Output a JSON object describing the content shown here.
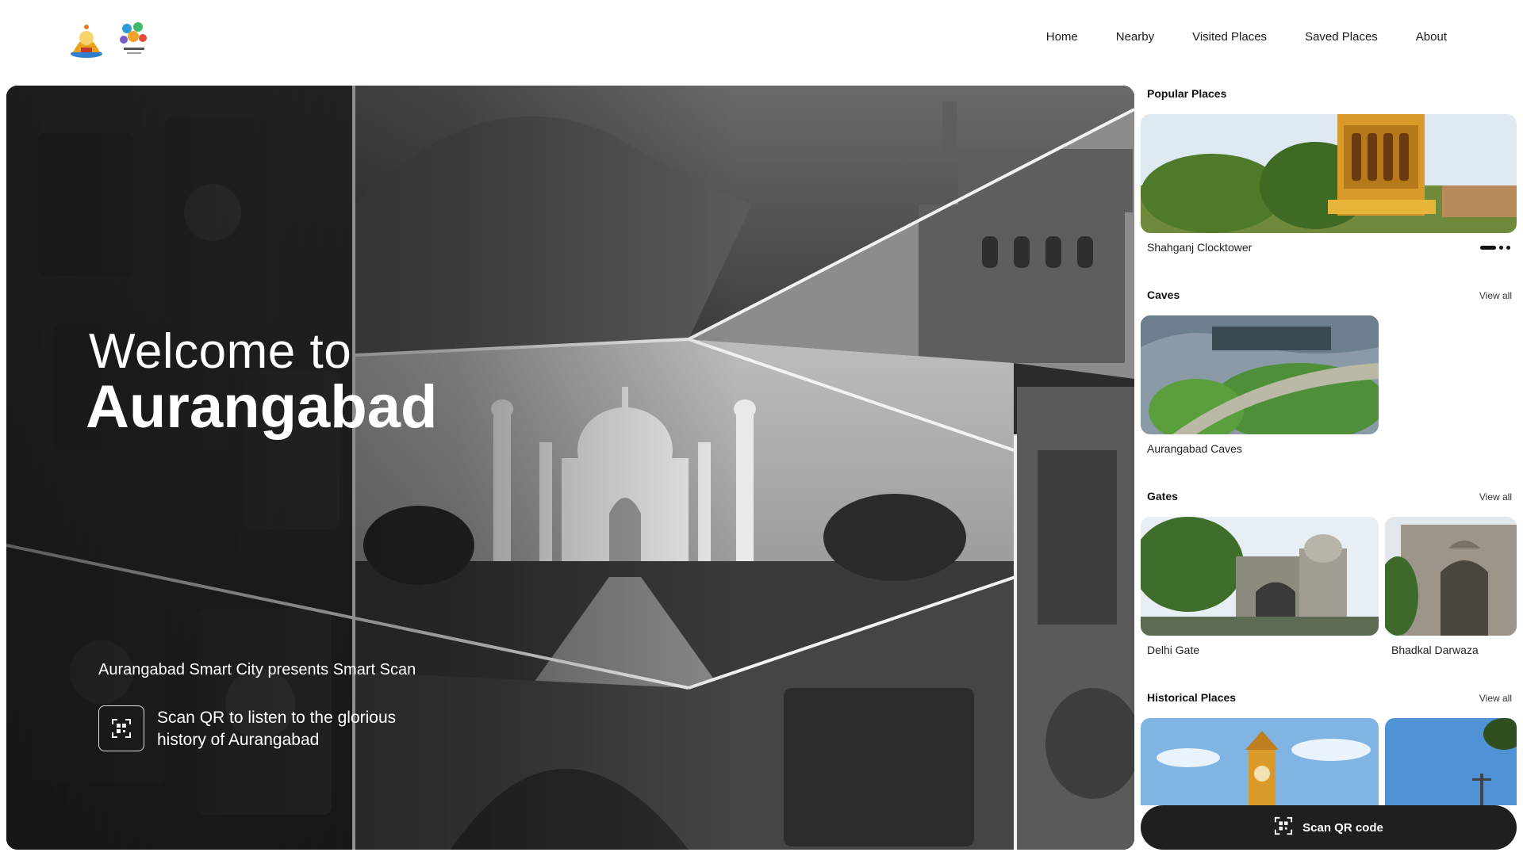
{
  "header": {
    "logos": [
      {
        "name": "aurangabad-municipal-emblem"
      },
      {
        "name": "aurangabad-smart-city-logo"
      }
    ],
    "nav": [
      "Home",
      "Nearby",
      "Visited Places",
      "Saved Places",
      "About"
    ]
  },
  "hero": {
    "welcome": "Welcome to",
    "city": "Aurangabad",
    "presents": "Aurangabad Smart City presents Smart Scan",
    "scan_text": "Scan QR to listen to the glorious history of Aurangabad",
    "icon": "qr-scan-icon"
  },
  "popular": {
    "title": "Popular Places",
    "item_label": "Shahganj Clocktower",
    "carousel": {
      "count": 3,
      "active": 0
    }
  },
  "caves": {
    "title": "Caves",
    "view_all": "View all",
    "items": [
      "Aurangabad Caves"
    ]
  },
  "gates": {
    "title": "Gates",
    "view_all": "View all",
    "items": [
      "Delhi Gate",
      "Bhadkal Darwaza"
    ]
  },
  "historical": {
    "title": "Historical Places",
    "view_all": "View all"
  },
  "scan_button": {
    "label": "Scan QR code",
    "icon": "qr-scan-icon"
  },
  "colors": {
    "button_bg": "#1f1f1f",
    "text": "#111111",
    "background": "#ffffff"
  }
}
